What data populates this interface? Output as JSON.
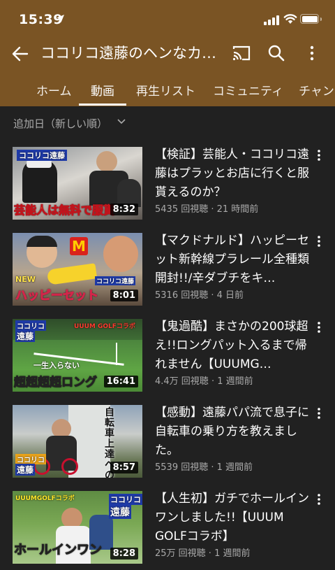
{
  "status": {
    "time": "15:39"
  },
  "appbar": {
    "title": "ココリコ遠藤のヘンなカ…"
  },
  "tabs": [
    {
      "label": "ホーム"
    },
    {
      "label": "動画"
    },
    {
      "label": "再生リスト"
    },
    {
      "label": "コミュニティ"
    },
    {
      "label": "チャンネ"
    }
  ],
  "active_tab": "動画",
  "sort": {
    "label": "追加日（新しい順）"
  },
  "colors": {
    "header": "#7a5424",
    "background": "#212121",
    "meta_text": "#aaaaaa"
  },
  "videos": [
    {
      "title": "【検証】芸能人・ココリコ遠藤はプラッとお店に行くと服貰えるのか？",
      "meta": "5435 回視聴 · 21 時間前",
      "duration": "8:32",
      "thumb_text": [
        "ココリコ遠藤",
        "芸能人は無料で服貰"
      ]
    },
    {
      "title": "【マクドナルド】ハッピーセット新幹線プラレール全種類開封!!/辛ダブチをキ…",
      "meta": "5316 回視聴 · 4 日前",
      "duration": "8:01",
      "thumb_text": [
        "NEW",
        "ハッピーセット",
        "ココリコ遠藤"
      ]
    },
    {
      "title": "【鬼過酷】まさかの200球超え!!ロングパット入るまで帰れません【UUUMG…",
      "meta": "4.4万 回視聴 · 1 週間前",
      "duration": "16:41",
      "thumb_text": [
        "ココリコ",
        "遠藤",
        "UUUM GOLFコラボ",
        "一生入らない",
        "超超超超ロング"
      ]
    },
    {
      "title": "【感動】遠藤パパ流で息子に自転車の乗り方を教えました。",
      "meta": "5539 回視聴 · 1 週間前",
      "duration": "8:57",
      "thumb_text": [
        "自転車上達への道",
        "ココリコ",
        "遠藤"
      ]
    },
    {
      "title": "【人生初】ガチでホールインワンしました!!【UUUM GOLFコラボ】",
      "meta": "25万 回視聴 · 1 週間前",
      "duration": "8:28",
      "thumb_text": [
        "UUUMGOLFコラボ",
        "ココリコ",
        "遠藤",
        "ホールインワン"
      ]
    }
  ]
}
